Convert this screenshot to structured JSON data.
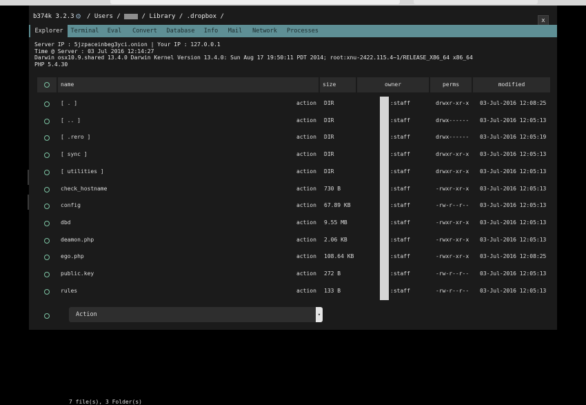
{
  "app": {
    "brand": "b374k 3.2.3",
    "path_parts": [
      "/",
      "Users",
      "/",
      "",
      "/",
      "Library",
      "/",
      ".dropbox",
      "/"
    ]
  },
  "tabs": [
    {
      "label": "Explorer"
    },
    {
      "label": "Terminal"
    },
    {
      "label": "Eval"
    },
    {
      "label": "Convert"
    },
    {
      "label": "Database"
    },
    {
      "label": "Info"
    },
    {
      "label": "Mail"
    },
    {
      "label": "Network"
    },
    {
      "label": "Processes"
    }
  ],
  "info": {
    "server_ip_label": "Server IP : ",
    "server_ip": "5jzpaceinbeg3yci.onion",
    "sep": " | ",
    "your_ip_label": "Your IP : ",
    "your_ip": "127.0.0.1",
    "time_label": "Time @ Server : ",
    "time": "03 Jul 2016 12:14:27",
    "uname": "Darwin osx10.9.shared 13.4.0 Darwin Kernel Version 13.4.0: Sun Aug 17 19:50:11 PDT 2014; root:xnu-2422.115.4~1/RELEASE_X86_64 x86_64",
    "php": "PHP 5.4.30"
  },
  "table": {
    "headers": {
      "name": "name",
      "size": "size",
      "owner": "owner",
      "perms": "perms",
      "modified": "modified"
    },
    "action_label": "action",
    "rows": [
      {
        "name": "[ . ]",
        "size": "DIR",
        "owner": ":staff",
        "perms": "drwxr-xr-x",
        "modified": "03-Jul-2016 12:08:25"
      },
      {
        "name": "[ .. ]",
        "size": "DIR",
        "owner": ":staff",
        "perms": "drwx------",
        "modified": "03-Jul-2016 12:05:13"
      },
      {
        "name": "[ .rero ]",
        "size": "DIR",
        "owner": ":staff",
        "perms": "drwx------",
        "modified": "03-Jul-2016 12:05:19"
      },
      {
        "name": "[ sync ]",
        "size": "DIR",
        "owner": ":staff",
        "perms": "drwxr-xr-x",
        "modified": "03-Jul-2016 12:05:13"
      },
      {
        "name": "[ utilities ]",
        "size": "DIR",
        "owner": ":staff",
        "perms": "drwxr-xr-x",
        "modified": "03-Jul-2016 12:05:13"
      },
      {
        "name": "check_hostname",
        "size": "730 B",
        "owner": ":staff",
        "perms": "-rwxr-xr-x",
        "modified": "03-Jul-2016 12:05:13"
      },
      {
        "name": "config",
        "size": "67.89 KB",
        "owner": ":staff",
        "perms": "-rw-r--r--",
        "modified": "03-Jul-2016 12:05:13"
      },
      {
        "name": "dbd",
        "size": "9.55 MB",
        "owner": ":staff",
        "perms": "-rwxr-xr-x",
        "modified": "03-Jul-2016 12:05:13"
      },
      {
        "name": "deamon.php",
        "size": "2.06 KB",
        "owner": ":staff",
        "perms": "-rwxr-xr-x",
        "modified": "03-Jul-2016 12:05:13"
      },
      {
        "name": "ego.php",
        "size": "108.64 KB",
        "owner": ":staff",
        "perms": "-rwxr-xr-x",
        "modified": "03-Jul-2016 12:08:25"
      },
      {
        "name": "public.key",
        "size": "272 B",
        "owner": ":staff",
        "perms": "-rw-r--r--",
        "modified": "03-Jul-2016 12:05:13"
      },
      {
        "name": "rules",
        "size": "133 B",
        "owner": ":staff",
        "perms": "-rw-r--r--",
        "modified": "03-Jul-2016 12:05:13"
      }
    ],
    "select_label": "Action",
    "footer": "7 file(s), 3 Folder(s)"
  },
  "colors": {
    "tabbar": "#5e8f95",
    "radio": "#7dc4a4",
    "bg": "#1b1b1b"
  },
  "icons": {
    "gear": "gear-icon",
    "close": "close-icon",
    "caret": "chevron-down-icon"
  }
}
